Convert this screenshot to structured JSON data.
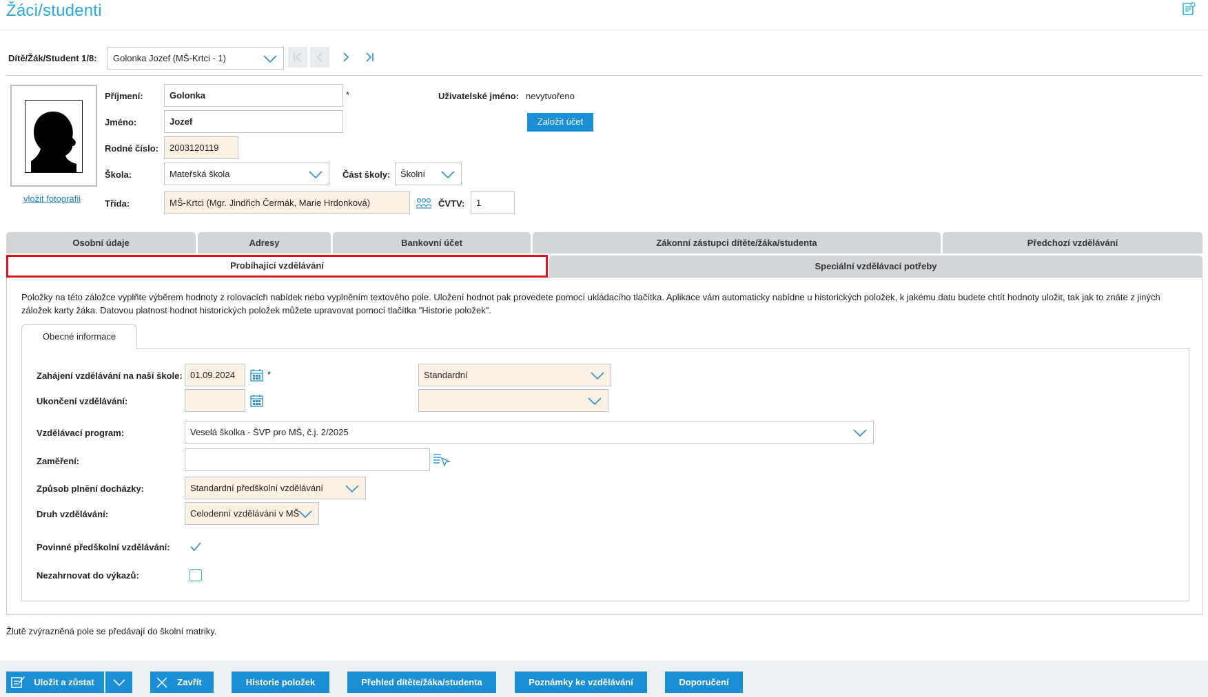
{
  "header": {
    "title": "Žáci/studenti"
  },
  "nav": {
    "label": "Dítě/Žák/Student 1/8:",
    "selected_student": "Golonka Jozef (MŠ-Krtci - 1)"
  },
  "photo": {
    "link_label": "vložit fotografii"
  },
  "form": {
    "surname_label": "Příjmení:",
    "surname_value": "Golonka",
    "required_mark": "*",
    "firstname_label": "Jméno:",
    "firstname_value": "Jozef",
    "birth_number_label": "Rodné číslo:",
    "birth_number_value": "2003120119",
    "school_label": "Škola:",
    "school_value": "Mateřská škola",
    "school_part_label": "Část školy:",
    "school_part_value": "Školní",
    "class_label": "Třída:",
    "class_value": "MŠ-Krtci (Mgr. Jindřich Čermák, Marie Hrdonková)",
    "cvtv_label": "ČVTV:",
    "cvtv_value": "1",
    "username_label": "Uživatelské jméno:",
    "username_value": "nevytvořeno",
    "create_account_label": "Založit účet"
  },
  "tabs": {
    "row1": [
      "Osobní údaje",
      "Adresy",
      "Bankovní účet",
      "Zákonní zástupci dítěte/žáka/studenta",
      "Předchozí vzdělávání"
    ],
    "row2": [
      "Probíhající vzdělávání",
      "Speciální vzdělávací potřeby"
    ]
  },
  "panel": {
    "info_text": "Položky na této záložce vyplňte výběrem hodnoty z rolovacích nabídek nebo vyplněním textového pole. Uložení hodnot pak provedete pomocí ukládacího tlačítka. Aplikace vám automaticky nabídne u historických položek, k jakému datu budete chtít hodnoty uložit, tak jak to znáte z jiných záložek karty žáka. Datovou platnost hodnot historických položek můžete upravovat pomocí tlačítka \"Historie položek\".",
    "subtab_label": "Obecné informace"
  },
  "education": {
    "start_label": "Zahájení vzdělávání na naší škole:",
    "start_date": "01.09.2024",
    "start_type": "Standardní",
    "end_label": "Ukončení vzdělávání:",
    "end_date": "",
    "end_type": "",
    "program_label": "Vzdělávací program:",
    "program_value": "Veselá školka - ŠVP pro MŠ, č.j. 2/2025",
    "focus_label": "Zaměření:",
    "focus_value": "",
    "attendance_label": "Způsob plnění docházky:",
    "attendance_value": "Standardní předškolní vzdělávání",
    "kind_label": "Druh vzdělávání:",
    "kind_value": "Celodenní vzdělávání v MŠ",
    "mandatory_label": "Povinné předškolní vzdělávání:",
    "mandatory_checked": true,
    "exclude_label": "Nezahrnovat do výkazů:",
    "exclude_checked": false
  },
  "footnote": "Žlutě zvýrazněná pole se předávají do školní matriky.",
  "toolbar": {
    "save_label": "Uložit a zůstat",
    "close_label": "Zavřít",
    "history_label": "Historie položek",
    "overview_label": "Přehled dítěte/žáka/studenta",
    "notes_label": "Poznámky ke vzdělávání",
    "recommend_label": "Doporučení"
  },
  "colors": {
    "accent": "#1b8fd6",
    "title": "#2aa7de",
    "highlight_field": "#fdf1e3",
    "active_tab_border": "#e0141c"
  }
}
